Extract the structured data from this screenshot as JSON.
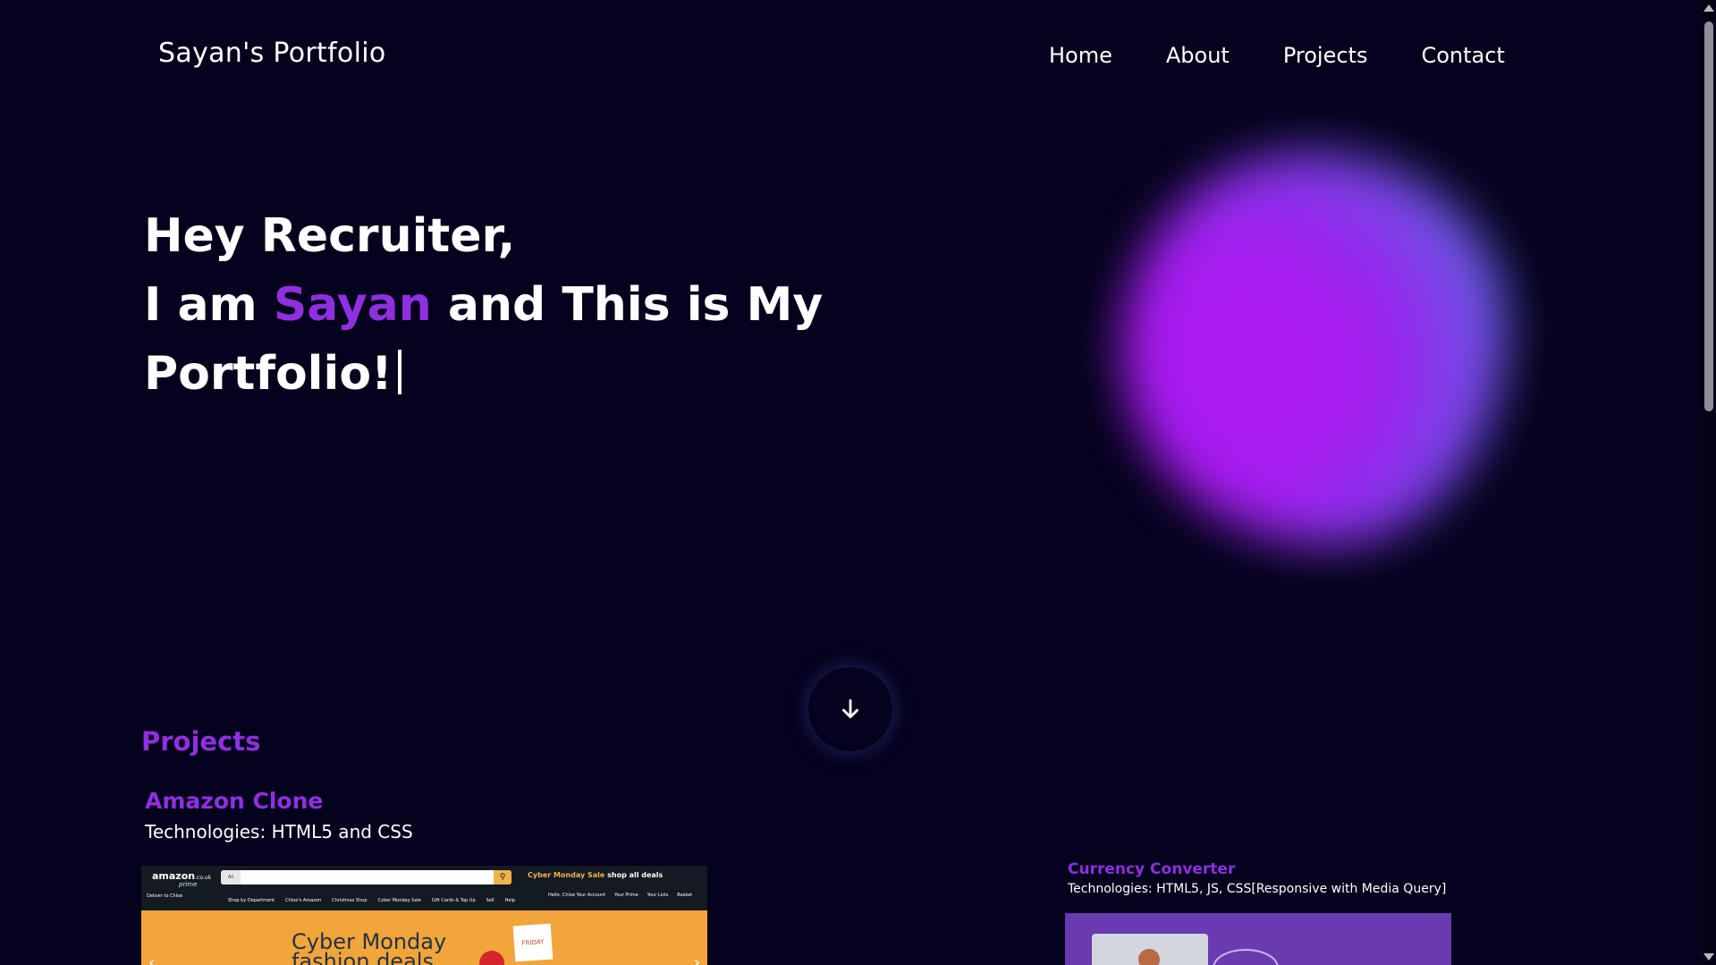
{
  "header": {
    "brand": "Sayan's Portfolio",
    "nav": [
      {
        "label": "Home"
      },
      {
        "label": "About"
      },
      {
        "label": "Projects"
      },
      {
        "label": "Contact"
      }
    ]
  },
  "hero": {
    "line1": "Hey Recruiter,",
    "line2_prefix": "I am ",
    "name": "Sayan",
    "line2_suffix": " and This is My",
    "line3": "Portfolio!"
  },
  "projects": {
    "heading": "Projects",
    "items": [
      {
        "title": "Amazon Clone",
        "tech": "Technologies: HTML5 and CSS",
        "preview": {
          "logo": "amazon",
          "logo_tld": ".co.uk",
          "prime": "prime",
          "deliver": "Deliver to Chloe",
          "search_all": "All",
          "promo": "Cyber Monday Sale",
          "promo_link": "shop all deals",
          "links": [
            "Shop by Department",
            "Chloe's Amazon",
            "Christmas Shop",
            "Cyber Monday Sale",
            "Gift Cards & Top Up",
            "Sell",
            "Help"
          ],
          "account": [
            "Hello, Chloe Your Account",
            "Your Prime",
            "Your Lists",
            "Basket"
          ],
          "banner": "Cyber Monday",
          "banner_sub": "fashion deals",
          "friday": "FRIDAY"
        }
      },
      {
        "title": "Currency Converter",
        "tech": "Technologies: HTML5, JS, CSS[Responsive with Media Query]"
      }
    ]
  },
  "colors": {
    "background": "#04021c",
    "accent": "#8f2fe0",
    "text": "#ffffff"
  },
  "icons": {
    "scroll_down": "arrow-down-icon"
  }
}
